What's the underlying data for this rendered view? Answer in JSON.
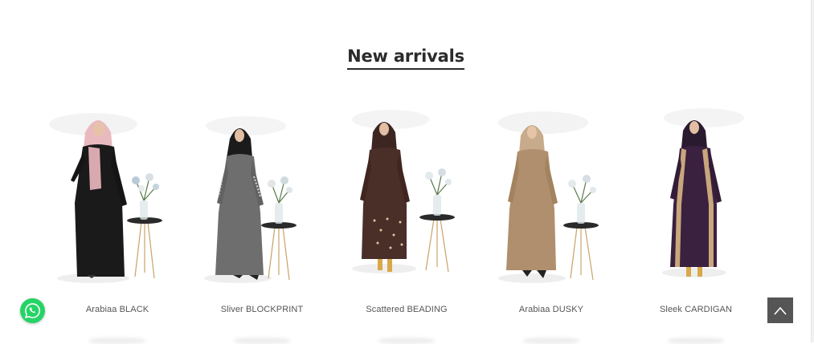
{
  "section": {
    "title": "New arrivals"
  },
  "products": [
    {
      "name": "Arabiaa BLACK"
    },
    {
      "name": "Sliver BLOCKPRINT"
    },
    {
      "name": "Scattered BEADING"
    },
    {
      "name": "Arabiaa DUSKY"
    },
    {
      "name": "Sleek CARDIGAN"
    }
  ],
  "colors": {
    "title_text": "#2b2b2b",
    "product_name_text": "#555555",
    "whatsapp_green": "#25d366",
    "scroll_top_bg": "#555555",
    "abaya_black": "#1a1a1a",
    "abaya_grey": "#6e6e6e",
    "abaya_brown": "#4a2e28",
    "abaya_beige": "#b08f6e",
    "abaya_purple": "#3a2140"
  },
  "icons": {
    "whatsapp": "whatsapp-icon",
    "scroll_top": "chevron-up-icon"
  }
}
